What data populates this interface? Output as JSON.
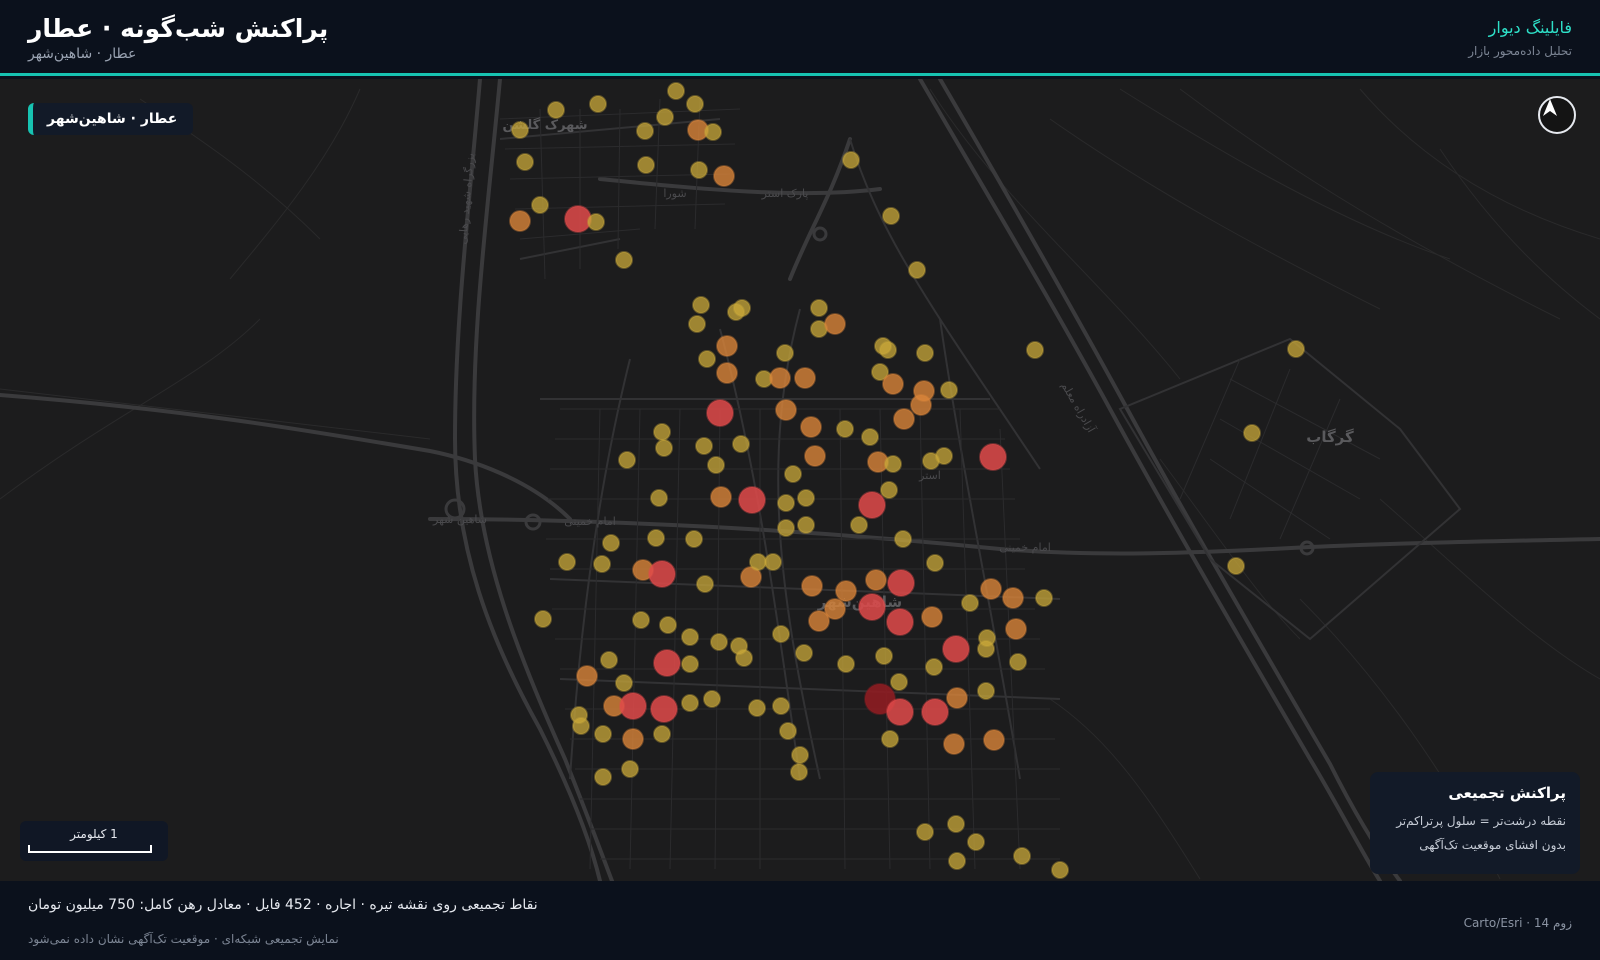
{
  "header": {
    "title": "پراکنش شب‌گونه · عطار",
    "subtitle": "عطار · شاهین‌شهر",
    "brand": "فایلینگ دیوار",
    "tagline": "تحلیل داده‌محور بازار"
  },
  "map": {
    "area_chip": "عطار · شاهین‌شهر",
    "north_arrow_icon": "navigation-arrow-icon",
    "place_labels": {
      "shahrak_golshan": "شهرک گلشن",
      "shahinshahr": "شاهین‌شهر",
      "gorgab": "گرگاب",
      "imam_khomeini": "امام خمینی",
      "shahin_shahr_road": "شاهین شهر",
      "bolvar_shahid_rahaei": "بزرگراه شهید رهایی",
      "azadrah_moallem": "آزادراه معلم",
      "sura": "شورا",
      "astar": "استر",
      "park_astar": "پارک استر"
    },
    "scale_label": "1 کیلومتر",
    "legend": {
      "title": "پراکنش تجمیعی",
      "line1": "نقطه درشت‌تر = سلول پرتراکم‌تر",
      "line2": "بدون افشای موقعیت تک‌آگهی"
    },
    "colors": {
      "background": "#1c1c1d",
      "low": "#c9a83a",
      "mid": "#d9853a",
      "high": "#e04a4a",
      "max": "#8e1d22",
      "accent": "#17c3b2"
    }
  },
  "footer": {
    "summary": "نقاط تجمیعی روی نقشه تیره · اجاره · 452 فایل · معادل رهن کامل: 750 میلیون تومان",
    "note": "نمایش تجمیعی شبکه‌ای · موقعیت تک‌آگهی نشان داده نمی‌شود",
    "attribution": "Carto/Esri · زوم 14"
  }
}
